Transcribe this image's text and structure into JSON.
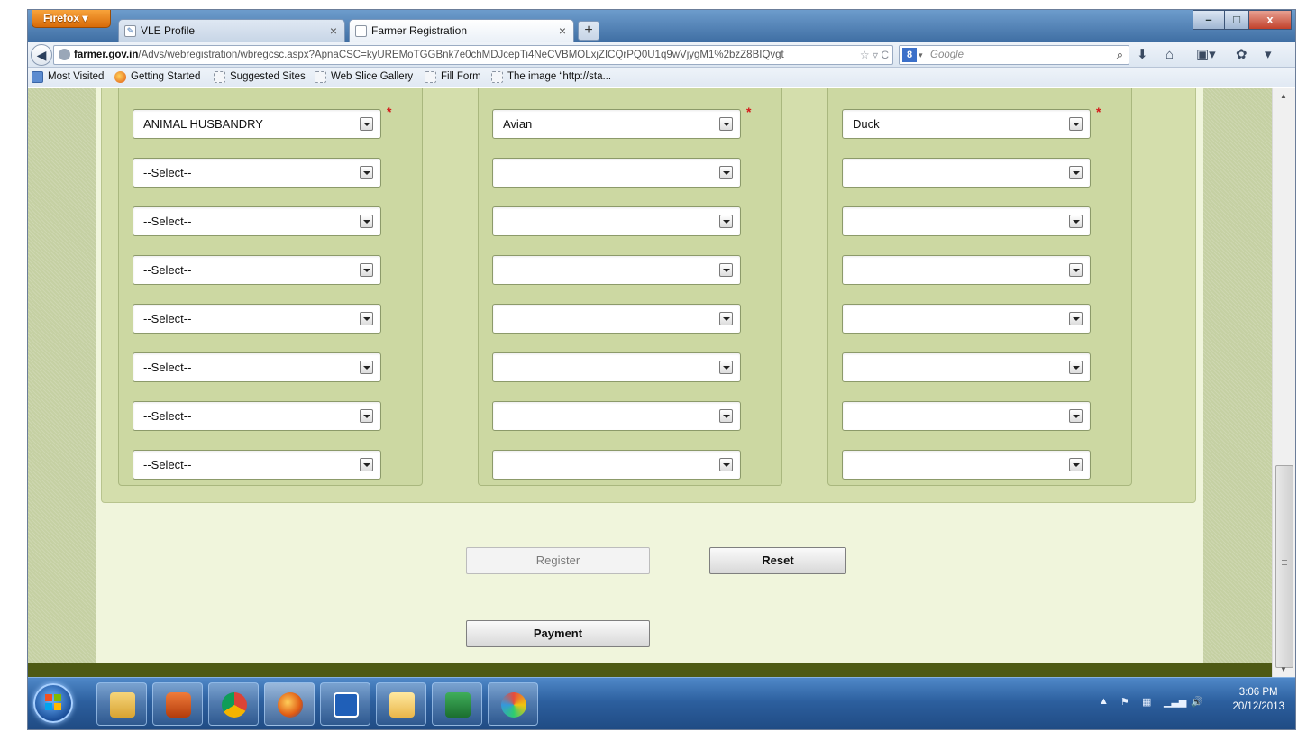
{
  "browser": {
    "menu_label": "Firefox",
    "tabs": [
      {
        "title": "VLE Profile",
        "active": false,
        "close": "×"
      },
      {
        "title": "Farmer Registration",
        "active": true,
        "close": "×"
      }
    ],
    "new_tab_label": "+",
    "window_controls": {
      "minimize": "–",
      "maximize": "□",
      "close": "x"
    },
    "url_host": "farmer.gov.in",
    "url_path": "/Advs/webregistration/wbregcsc.aspx?ApnaCSC=kyUREMoTGGBnk7e0chMDJcepTi4NeCVBMOLxjZICQrPQ0U1q9wVjygM1%2bzZ8BIQvgt",
    "url_actions": "☆ ▿ C",
    "search_engine_glyph": "8",
    "search_placeholder": "Google",
    "bookmarks": [
      {
        "label": "Most Visited",
        "icon": "blue"
      },
      {
        "label": "Getting Started",
        "icon": "firefox"
      },
      {
        "label": "Suggested Sites",
        "icon": "page"
      },
      {
        "label": "Web Slice Gallery",
        "icon": "page"
      },
      {
        "label": "Fill Form",
        "icon": "page"
      },
      {
        "label": "The image “http://sta...",
        "icon": "page"
      }
    ]
  },
  "form": {
    "sectors": [
      "ANIMAL HUSBANDRY",
      "--Select--",
      "--Select--",
      "--Select--",
      "--Select--",
      "--Select--",
      "--Select--",
      "--Select--"
    ],
    "categories": [
      "Avian",
      "",
      "",
      "",
      "",
      "",
      "",
      ""
    ],
    "items": [
      "Duck",
      "",
      "",
      "",
      "",
      "",
      "",
      ""
    ],
    "required_mark": "*",
    "register_label": "Register",
    "register_enabled": false,
    "reset_label": "Reset",
    "payment_label": "Payment"
  },
  "taskbar": {
    "apps": [
      "explorer",
      "media-player",
      "chrome",
      "firefox",
      "maxthon",
      "outlook",
      "excel",
      "paint"
    ],
    "clock_time": "3:06 PM",
    "clock_date": "20/12/2013"
  },
  "colors": {
    "page_background": "#f0f5dc",
    "section_background": "#d4deac",
    "required": "#d41a1a",
    "footer": "#4e5a14"
  }
}
